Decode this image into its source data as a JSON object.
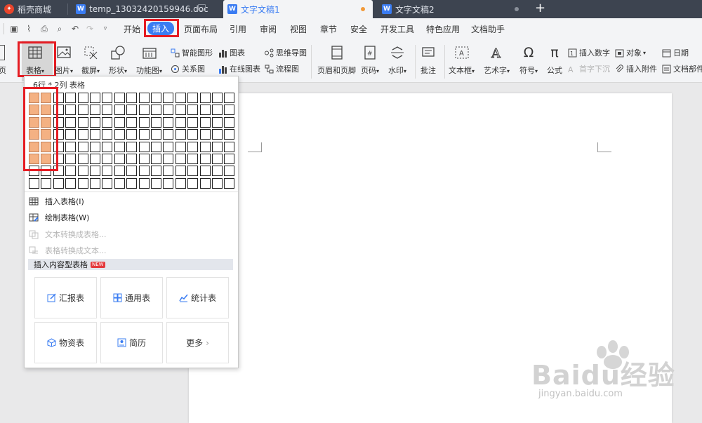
{
  "tabs": {
    "store": "稻壳商城",
    "doc": "temp_13032420159946.doc",
    "active": "文字文稿1",
    "other": "文字文稿2",
    "new_tab": "+"
  },
  "menu": [
    "开始",
    "插入",
    "页面布局",
    "引用",
    "审阅",
    "视图",
    "章节",
    "安全",
    "开发工具",
    "特色应用",
    "文档助手"
  ],
  "ribbon": {
    "page_partial": "页",
    "table": "表格",
    "picture": "图片",
    "screenshot": "截屏",
    "shape": "形状",
    "function_chart": "功能图",
    "smart_graphic": "智能图形",
    "chart": "图表",
    "mind_map": "思维导图",
    "relation_chart": "关系图",
    "online_chart": "在线图表",
    "flowchart": "流程图",
    "header_footer": "页眉和页脚",
    "page_number": "页码",
    "watermark": "水印",
    "comment": "批注",
    "text_box": "文本框",
    "art_text": "艺术字",
    "symbol": "符号",
    "formula": "公式",
    "insert_number": "插入数字",
    "drop_cap": "首字下沉",
    "object": "对象",
    "insert_attachment": "插入附件",
    "date": "日期",
    "doc_parts": "文档部件",
    "dropdown_arrow": "▾"
  },
  "panel": {
    "grid_label": "6行 * 2列 表格",
    "grid_rows": 8,
    "grid_cols": 17,
    "selected_rows": 6,
    "selected_cols": 2,
    "insert_table": "插入表格(I)",
    "draw_table": "绘制表格(W)",
    "text_to_table": "文本转换成表格...",
    "table_to_text": "表格转换成文本...",
    "content_table_header": "插入内容型表格",
    "new_badge": "NEW",
    "cards": [
      "汇报表",
      "通用表",
      "统计表",
      "物资表",
      "简历",
      "更多"
    ]
  },
  "watermark": {
    "brand": "Baidu经验",
    "url": "jingyan.baidu.com"
  },
  "colors": {
    "accent": "#3a7cf2",
    "highlight": "#e51c23",
    "grid_selected": "#f4b183",
    "tabbar": "#3d4450"
  }
}
